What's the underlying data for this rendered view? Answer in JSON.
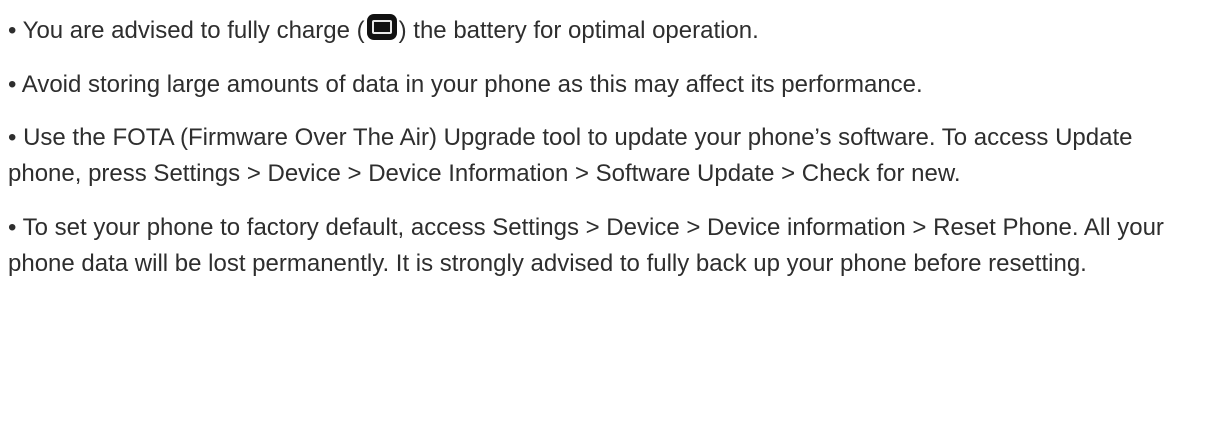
{
  "bullets": [
    {
      "text_before_icon": "• You are advised to fully charge (",
      "icon": "battery-full-icon",
      "text_after_icon": ") the battery for optimal operation."
    },
    {
      "text": "• Avoid storing large amounts of data in your phone as this may affect its performance."
    },
    {
      "text": "• Use the FOTA (Firmware Over The Air) Upgrade tool to update your phone’s software. To access Update phone, press Settings > Device > Device Information > Software Update > Check for new."
    },
    {
      "text": "• To set your phone to factory default, access Settings > Device > Device information > Reset Phone. All your phone data will be lost permanently. It is strongly advised to fully back up your phone before resetting."
    }
  ]
}
